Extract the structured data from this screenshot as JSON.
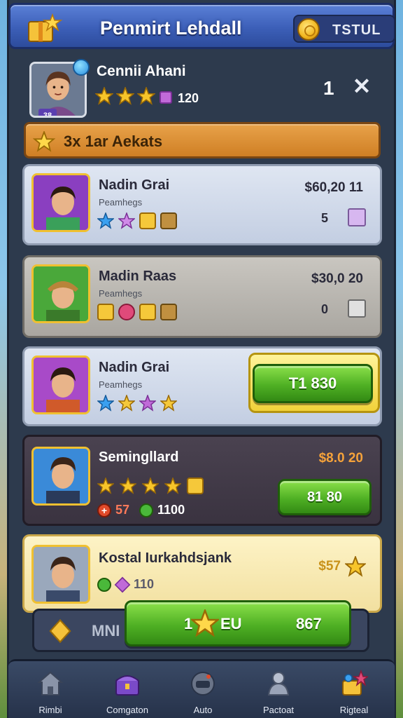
{
  "header": {
    "title": "Penmirt Lehdall",
    "currency_label": "TSTUL"
  },
  "player": {
    "name": "Cennii Ahani",
    "points": "120",
    "level": "38",
    "count": "1",
    "stars": 3
  },
  "banner": {
    "text": "3x 1ar Aekats"
  },
  "rows": [
    {
      "name": "Nadin Grai",
      "sub": "Peamhegs",
      "price": "$60,20 11",
      "qty": "5",
      "star_colors": [
        "#3aa0f0",
        "#d08ae8",
        "#f5c83a",
        "#c09040"
      ]
    },
    {
      "name": "Madin Raas",
      "sub": "Peamhegs",
      "price": "$30,0 20",
      "qty": "0",
      "star_colors": [
        "#f5c83a",
        "#e04a7a",
        "#f5c83a",
        "#c09040"
      ]
    },
    {
      "name": "Nadin Grai",
      "sub": "Peamhegs",
      "button_label": "T1 830",
      "star_colors": [
        "#3aa0f0",
        "#f5c83a",
        "#c06ad8",
        "#f5c83a"
      ]
    },
    {
      "name": "Semingllard",
      "price": "$8.0 20",
      "stat1": "57",
      "stat2": "1100",
      "button_label": "81 80"
    },
    {
      "name": "Kostal Iurkahdsjank",
      "price": "$57",
      "stat": "110"
    }
  ],
  "buy_bar": {
    "label": "MNI",
    "button_left": "1",
    "button_mid": "EU",
    "button_right": "867"
  },
  "nav": [
    {
      "label": "Rimbi",
      "icon": "house-icon"
    },
    {
      "label": "Comgaton",
      "icon": "chest-icon"
    },
    {
      "label": "Auto",
      "icon": "helmet-icon"
    },
    {
      "label": "Pactoat",
      "icon": "player-icon"
    },
    {
      "label": "Rigteal",
      "icon": "reward-icon"
    }
  ],
  "colors": {
    "header": "#3c5fb8",
    "banner": "#cf7f24",
    "button_green": "#4fb024",
    "frame": "#2d3a4d"
  }
}
